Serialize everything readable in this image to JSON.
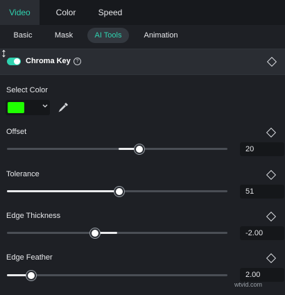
{
  "tabs_main": [
    {
      "label": "Video",
      "active": true
    },
    {
      "label": "Color",
      "active": false
    },
    {
      "label": "Speed",
      "active": false
    }
  ],
  "tabs_sub": [
    {
      "label": "Basic",
      "active": false
    },
    {
      "label": "Mask",
      "active": false
    },
    {
      "label": "AI Tools",
      "active": true
    },
    {
      "label": "Animation",
      "active": false
    }
  ],
  "chroma_key": {
    "title": "Chroma Key",
    "enabled": true,
    "select_color_label": "Select Color",
    "selected_color": "#1fff00",
    "sliders": [
      {
        "label": "Offset",
        "value": "20",
        "fraction": 0.6
      },
      {
        "label": "Tolerance",
        "value": "51",
        "fraction": 0.51
      },
      {
        "label": "Edge Thickness",
        "value": "-2.00",
        "fraction": 0.4
      },
      {
        "label": "Edge Feather",
        "value": "2.00",
        "fraction": 0.11
      }
    ]
  },
  "watermark": "wtvid.com",
  "colors": {
    "accent": "#2fd3b0",
    "background": "#1e2025",
    "header": "#2a2d33"
  }
}
